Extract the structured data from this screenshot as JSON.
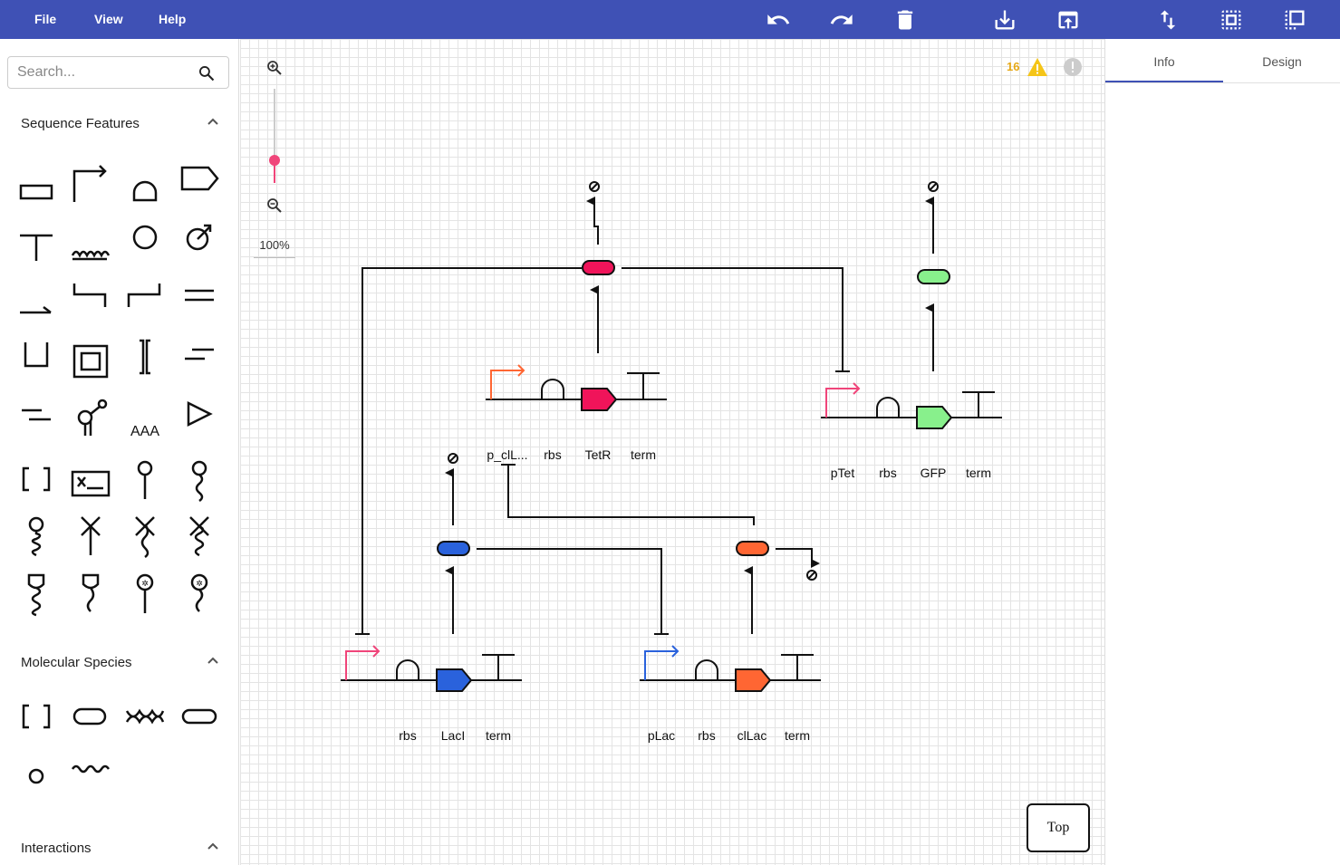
{
  "menu": {
    "file": "File",
    "view": "View",
    "help": "Help"
  },
  "toolbar": [
    "undo-icon",
    "redo-icon",
    "delete-icon",
    "download-icon",
    "upload-icon",
    "swap-vertical-icon",
    "select-area-icon",
    "select-all-icon"
  ],
  "search": {
    "placeholder": "Search..."
  },
  "sections": {
    "sequence": "Sequence Features",
    "molecular": "Molecular Species",
    "interactions": "Interactions"
  },
  "zoom": {
    "level": "100%",
    "slider_value": 0.5
  },
  "status": {
    "warnings": "16"
  },
  "canvas_button": "Top",
  "tabs": {
    "info": "Info",
    "design": "Design",
    "active": "info"
  },
  "colors": {
    "brand": "#3f51b5",
    "slider": "#f0457a",
    "tetr": "#f0145a",
    "laci": "#2a62dc",
    "clac": "#ff6633",
    "gfp": "#88f08c",
    "warning": "#f5c518"
  },
  "labels": {
    "tetr": {
      "promoter": "p_clL...",
      "rbs": "rbs",
      "cds": "TetR",
      "term": "term"
    },
    "gfp": {
      "promoter": "pTet",
      "rbs": "rbs",
      "cds": "GFP",
      "term": "term"
    },
    "laci": {
      "rbs": "rbs",
      "cds": "LacI",
      "term": "term"
    },
    "clac": {
      "promoter": "pLac",
      "rbs": "rbs",
      "cds": "clLac",
      "term": "term"
    }
  }
}
